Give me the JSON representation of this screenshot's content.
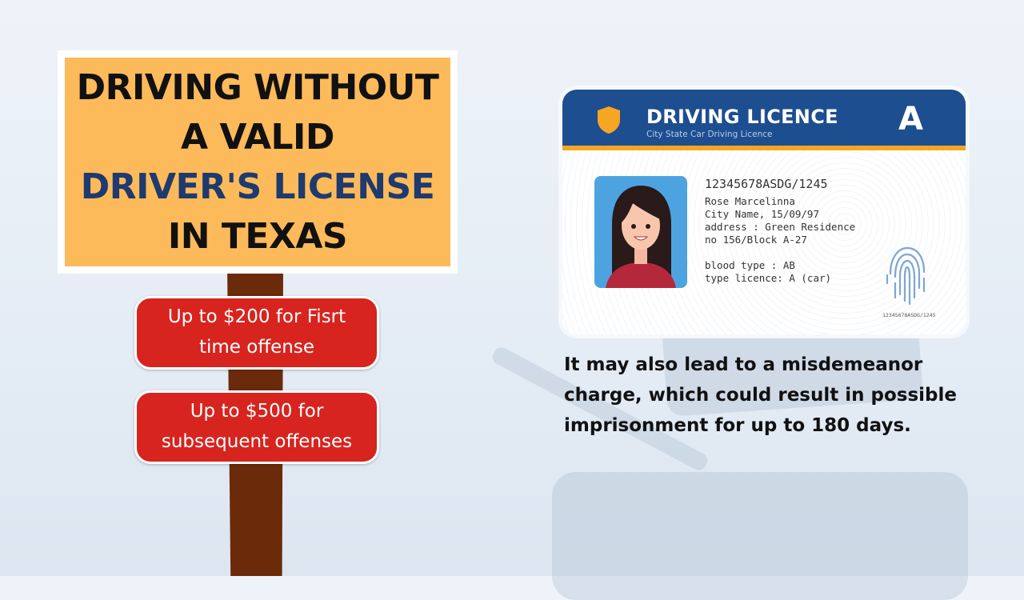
{
  "sign": {
    "line1": "DRIVING WITHOUT",
    "line2": "A VALID",
    "line3": "DRIVER'S LICENSE",
    "line4": "IN TEXAS"
  },
  "fines": [
    {
      "text": "Up to $200 for Fisrt time offense"
    },
    {
      "text": "Up to $500 for subsequent offenses"
    }
  ],
  "license": {
    "title": "DRIVING LICENCE",
    "subtitle": "City State Car Driving Licence",
    "class_letter": "A",
    "number": "12345678ASDG/1245",
    "name": "Rose Marcelinna",
    "city_dob": "City Name, 15/09/97",
    "address1": "address : Green Residence",
    "address2": "no 156/Block A-27",
    "blood": "blood type : AB",
    "type": "type licence: A (car)",
    "small_number": "12345678ASDG/1245"
  },
  "note": "It may also lead to a misdemeanor charge, which could result in possible imprisonment for up to 180 days.",
  "colors": {
    "sign_fill": "#fdba5a",
    "highlight_text": "#1e3a6e",
    "fine_fill": "#d7241f",
    "card_header": "#1d4e8f",
    "card_stripe": "#f5a623",
    "post": "#6b2a0a"
  }
}
